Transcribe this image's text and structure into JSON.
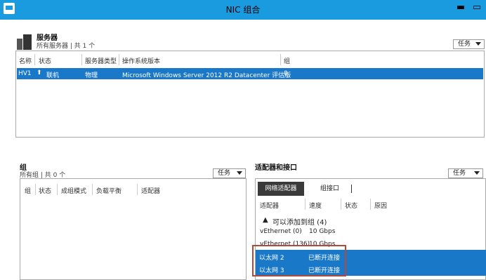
{
  "window": {
    "title": "NIC 组合",
    "min_glyph": "▬",
    "max_glyph": "▭"
  },
  "servers": {
    "title": "服务器",
    "subtitle": "所有服务器 | 共 1 个",
    "tasks_label": "任务",
    "columns": [
      "名称",
      "状态",
      "服务器类型",
      "操作系统版本",
      "组"
    ],
    "rows": [
      {
        "name": "HV1",
        "status": "联机",
        "type": "物理",
        "os": "Microsoft Windows Server 2012 R2 Datacenter 评估版",
        "groups": "0"
      }
    ]
  },
  "groups": {
    "title": "组",
    "subtitle": "所有组 | 共 0 个",
    "tasks_label": "任务",
    "columns": [
      "组",
      "状态",
      "成组模式",
      "负载平衡",
      "适配器"
    ]
  },
  "adapters": {
    "title": "适配器和接口",
    "tasks_label": "任务",
    "tabs": [
      "网络适配器",
      "组接口"
    ],
    "columns": [
      "适配器",
      "速度",
      "状态",
      "原因"
    ],
    "group_header": "可以添加到组 (4)",
    "rows": [
      {
        "name": "vEthernet (0)",
        "speed": "10 Gbps",
        "status": ""
      },
      {
        "name": "vEthernet (136)",
        "speed": "10 Gbps",
        "status": ""
      },
      {
        "name": "以太网 2",
        "speed": "",
        "status": "已断开连接"
      },
      {
        "name": "以太网 3",
        "speed": "",
        "status": "已断开连接"
      }
    ]
  },
  "colors": {
    "titlebar": "#1a9be0",
    "selection": "#1978c8",
    "highlight_border": "#b04a3a"
  }
}
